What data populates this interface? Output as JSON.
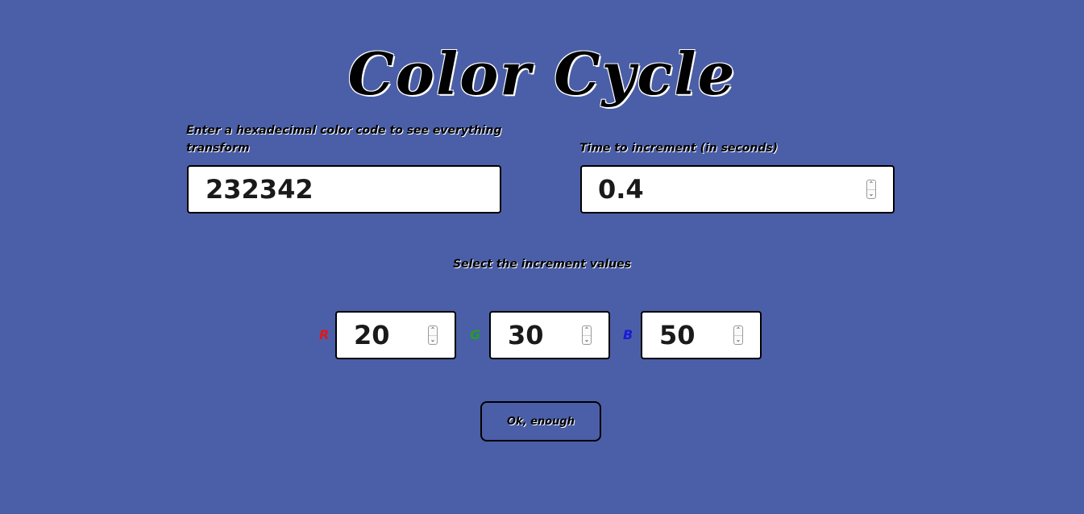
{
  "title": "Color Cycle",
  "hex": {
    "label": "Enter a hexadecimal color code to see everything transform",
    "value": "232342"
  },
  "time": {
    "label": "Time to increment (in seconds)",
    "value": "0.4"
  },
  "increments": {
    "label": "Select the increment values",
    "r": {
      "channel": "R",
      "value": "20"
    },
    "g": {
      "channel": "G",
      "value": "30"
    },
    "b": {
      "channel": "B",
      "value": "50"
    }
  },
  "button": {
    "label": "Ok, enough"
  },
  "colors": {
    "background": "#4b5fa8",
    "channel_r": "#e01818",
    "channel_g": "#22a022",
    "channel_b": "#1a1ad6"
  },
  "icons": {
    "spinner_up": "chevron-up-icon",
    "spinner_down": "chevron-down-icon"
  }
}
